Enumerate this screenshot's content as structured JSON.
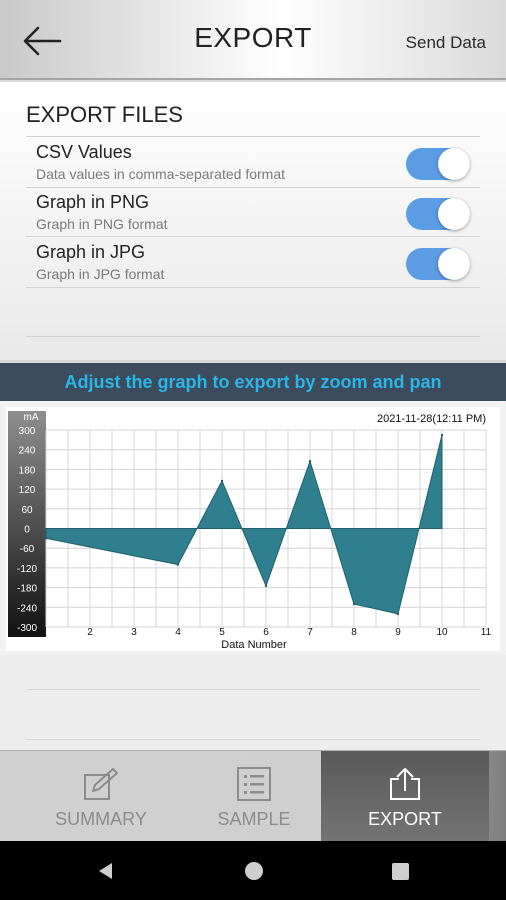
{
  "header": {
    "title": "EXPORT",
    "action_label": "Send Data"
  },
  "export_files": {
    "title": "EXPORT FILES",
    "items": [
      {
        "label": "CSV Values",
        "description": "Data values in comma-separated format",
        "enabled": true
      },
      {
        "label": "Graph in PNG",
        "description": "Graph in PNG format",
        "enabled": true
      },
      {
        "label": "Graph in JPG",
        "description": "Graph in JPG format",
        "enabled": true
      }
    ]
  },
  "banner": {
    "text": "Adjust the graph to export by zoom and pan"
  },
  "graph": {
    "timestamp": "2021-11-28(12:11 PM)"
  },
  "chart_data": {
    "type": "area",
    "title": "",
    "xlabel": "Data Number",
    "ylabel": "mA",
    "x": [
      1,
      4,
      5,
      6,
      7,
      8,
      9,
      10
    ],
    "y": [
      -30,
      -110,
      145,
      -175,
      205,
      -230,
      -260,
      285
    ],
    "xlim": [
      1,
      11
    ],
    "ylim": [
      -300,
      300
    ],
    "x_ticks": [
      2,
      3,
      4,
      5,
      6,
      7,
      8,
      9,
      10,
      11
    ],
    "y_ticks": [
      300,
      240,
      180,
      120,
      60,
      0,
      -60,
      -120,
      -180,
      -240,
      -300
    ],
    "grid": true,
    "colors": {
      "fill": "#2f7f8e",
      "line": "#1f5f6e"
    }
  },
  "tabs": [
    {
      "label": "SUMMARY",
      "icon": "edit-icon",
      "active": false
    },
    {
      "label": "SAMPLE",
      "icon": "list-icon",
      "active": false
    },
    {
      "label": "EXPORT",
      "icon": "share-icon",
      "active": true
    }
  ],
  "nav": {
    "back": "back-triangle-icon",
    "home": "home-circle-icon",
    "recents": "recents-square-icon"
  },
  "colors": {
    "toggle_on": "#5b9ce3",
    "banner_bg": "#3d4c5c",
    "banner_text": "#29b6e8"
  }
}
